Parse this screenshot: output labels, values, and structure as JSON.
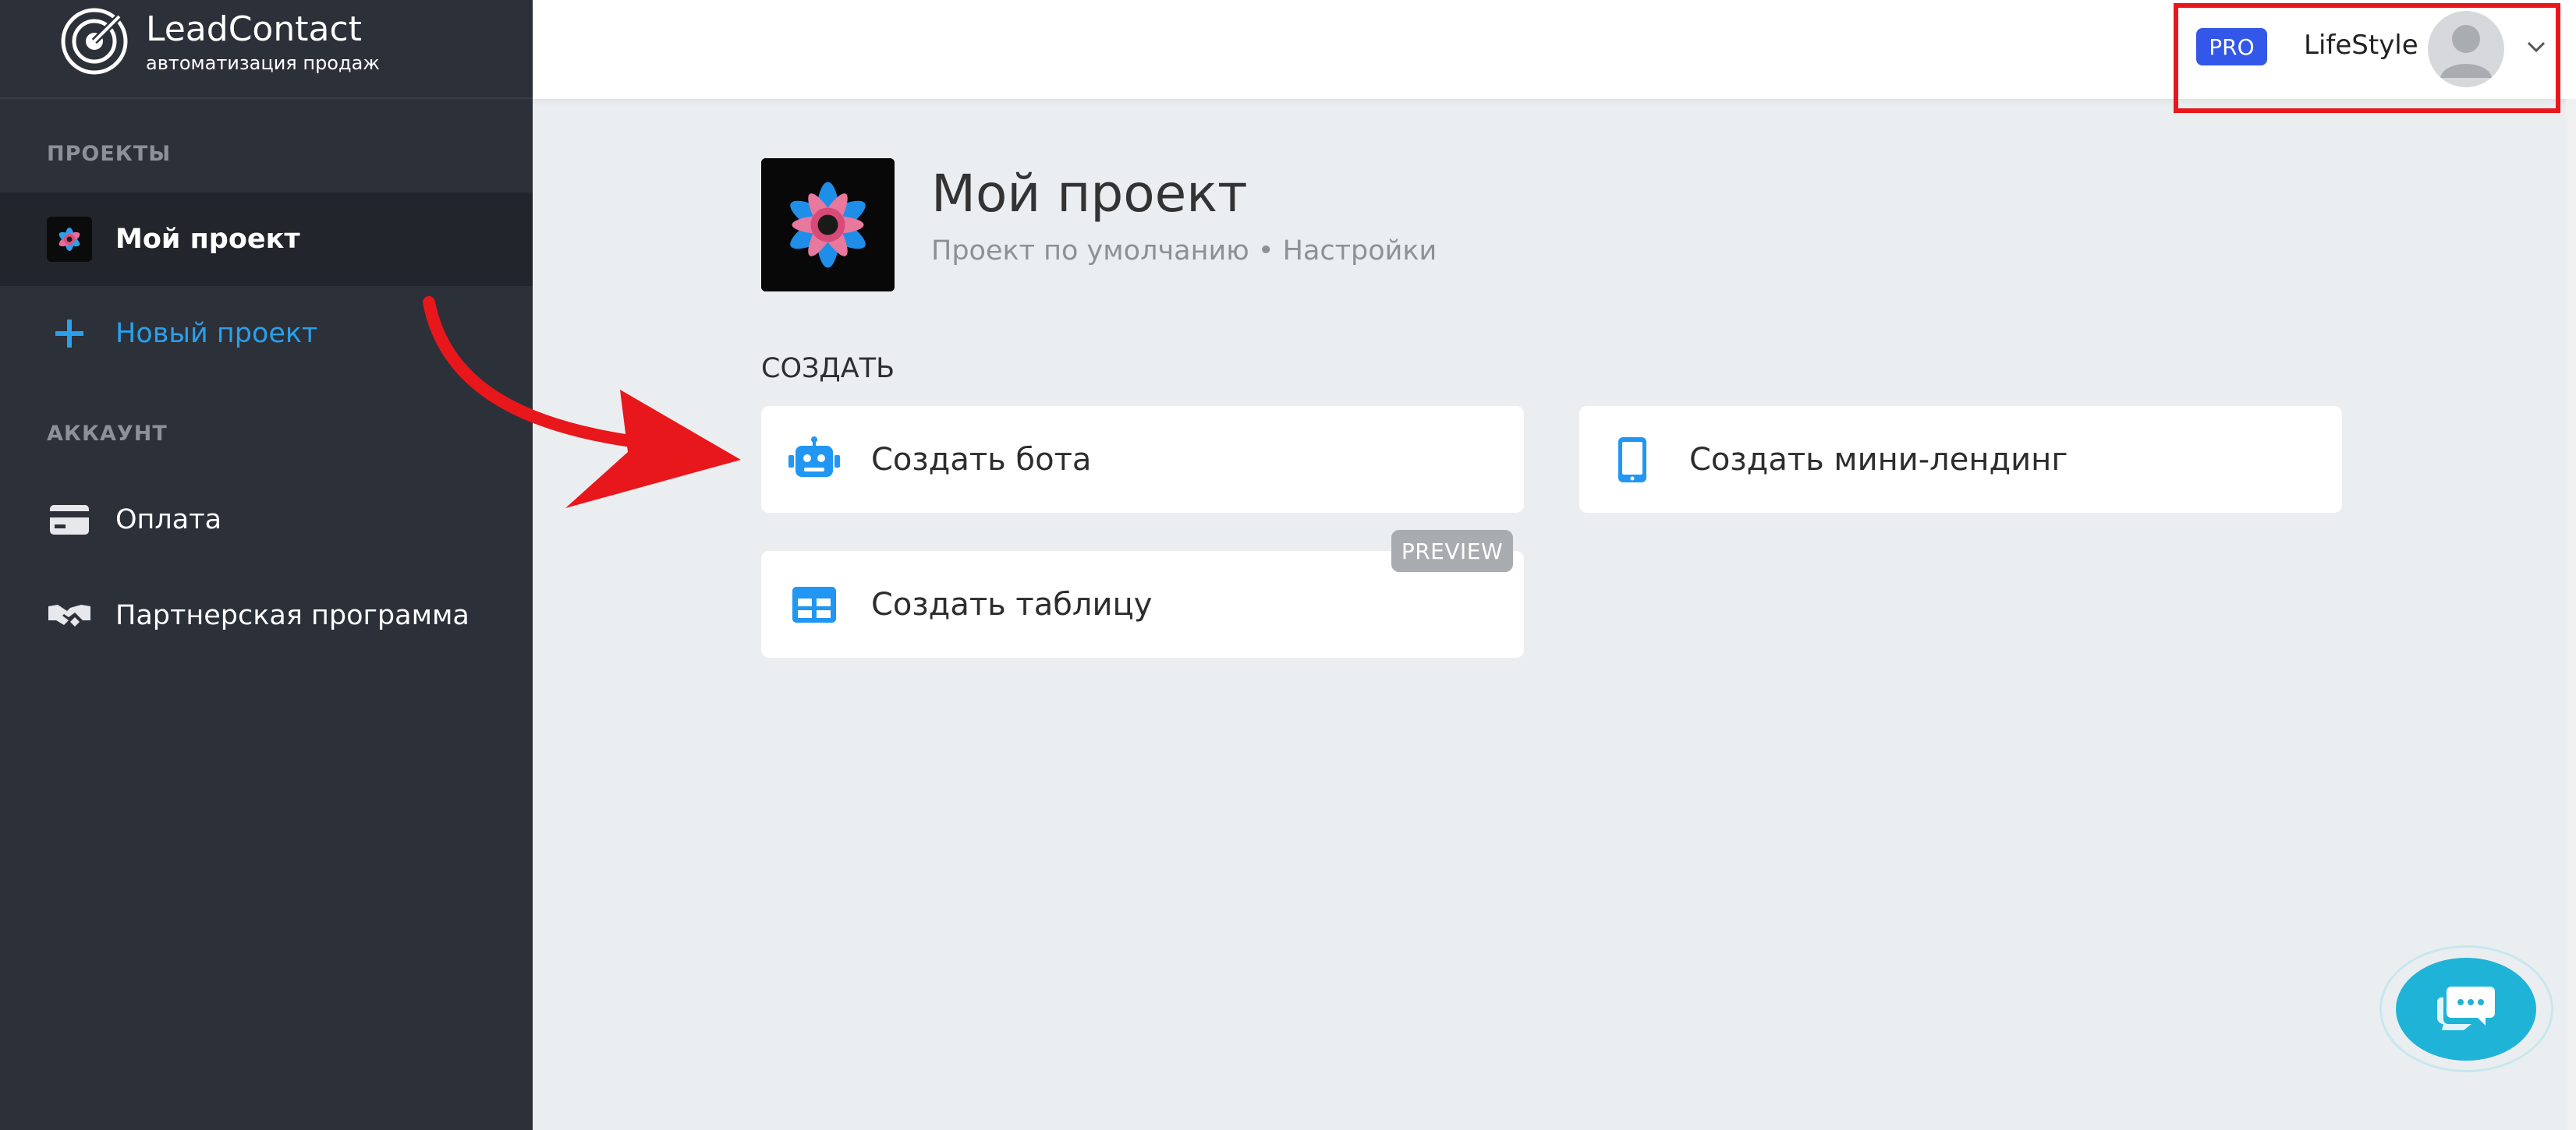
{
  "brand": {
    "name": "LeadContact",
    "tagline": "автоматизация продаж"
  },
  "sidebar": {
    "projects_heading": "ПРОЕКТЫ",
    "projects": [
      {
        "label": "Мой проект",
        "active": true,
        "icon": "project-flower-icon"
      },
      {
        "label": "Новый проект",
        "icon": "plus-icon"
      }
    ],
    "account_heading": "АККАУНТ",
    "account_items": [
      {
        "label": "Оплата",
        "icon": "credit-card-icon"
      },
      {
        "label": "Партнерская программа",
        "icon": "handshake-icon"
      }
    ]
  },
  "header": {
    "plan_badge": "PRO",
    "user_name": "LifeStyle",
    "avatar_icon": "user-avatar-icon",
    "menu_icon": "chevron-down-icon"
  },
  "project": {
    "title": "Мой проект",
    "subtitle_default": "Проект по умолчанию",
    "subtitle_separator": "•",
    "settings_link": "Настройки"
  },
  "create": {
    "heading": "СОЗДАТЬ",
    "cards": [
      {
        "label": "Создать бота",
        "icon": "robot-icon"
      },
      {
        "label": "Создать мини-лендинг",
        "icon": "smartphone-icon"
      },
      {
        "label": "Создать таблицу",
        "icon": "table-icon",
        "badge": "PREVIEW"
      }
    ]
  },
  "chat_widget": {
    "icon": "chat-bubbles-icon"
  },
  "colors": {
    "sidebar_bg": "#2c3039",
    "sidebar_active_bg": "#22252c",
    "accent_blue": "#2aa0ea",
    "pro_badge": "#3357e8",
    "highlight_red": "#e8171c",
    "chat_teal": "#1fb3d8",
    "content_bg": "#ebeef0"
  }
}
